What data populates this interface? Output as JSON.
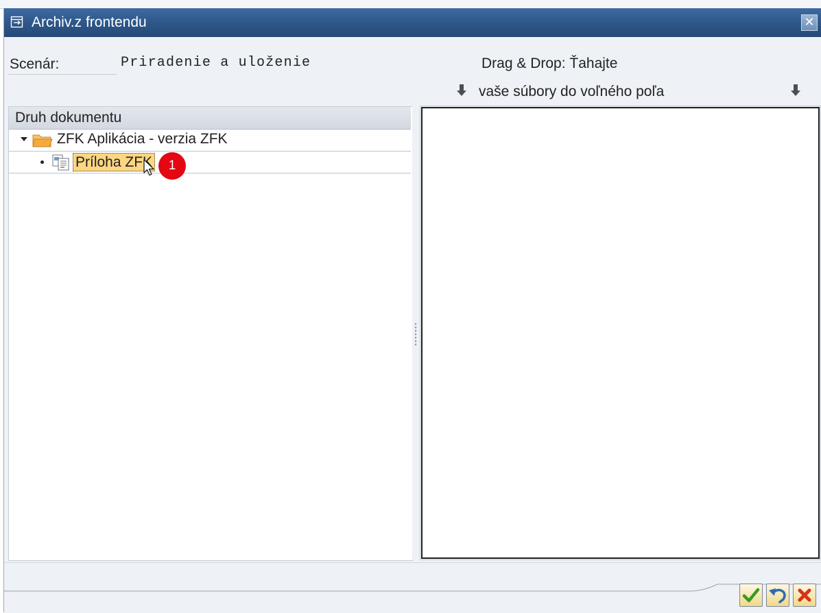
{
  "window": {
    "title": "Archiv.z frontendu",
    "close_glyph": "✕"
  },
  "scenario": {
    "label": "Scenár:",
    "value": "Priradenie a uloženie"
  },
  "drag_drop": {
    "line1": "Drag & Drop: Ťahajte",
    "line2": "vaše súbory do voľného poľa"
  },
  "tree": {
    "header": "Druh dokumentu",
    "folder": {
      "label": "ZFK Aplikácia - verzia ZFK",
      "expanded": true,
      "icon": "open-folder-icon"
    },
    "items": [
      {
        "label": "Príloha ZFK",
        "selected": true,
        "icon": "document-type-icon"
      }
    ]
  },
  "annotation": {
    "badge": "1"
  },
  "buttons": {
    "confirm": "checkmark-icon",
    "undo": "undo-icon",
    "cancel": "cancel-x-icon"
  },
  "colors": {
    "titlebar": "#2d5687",
    "selection": "#fdd681",
    "badge": "#e30613",
    "confirm_green": "#3a9a22",
    "cancel_red": "#d8331a",
    "undo_blue": "#2f6bb0"
  }
}
